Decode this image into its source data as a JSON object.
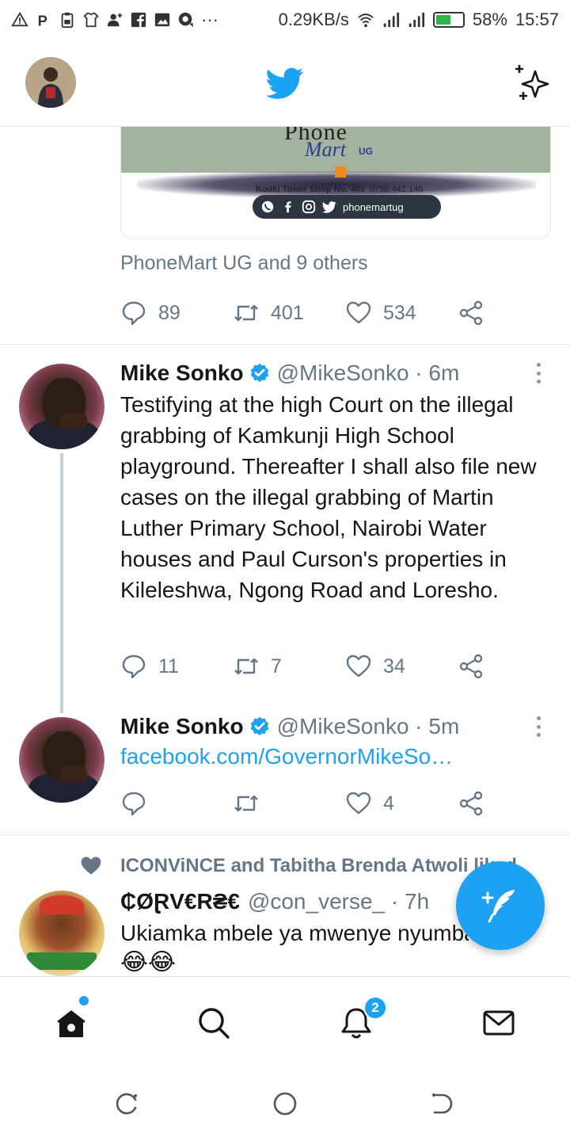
{
  "status_bar": {
    "speed": "0.29KB/s",
    "battery_percent": "58%",
    "battery_level": 0.58,
    "time": "15:57",
    "more_glyph": "···"
  },
  "header": {
    "logo_icon": "twitter-bird-icon",
    "right_icon": "sparkle-icon"
  },
  "feed": {
    "card": {
      "brand_top": "Phone",
      "brand_name": "Mart",
      "brand_suffix": "UG",
      "shop_name": "Kooki Tower Shop No. 463",
      "shop_phone": "0756 442 146",
      "social_handle": "phonemartug"
    },
    "tweet0": {
      "social_context": "PhoneMart UG and 9 others",
      "replies": "89",
      "retweets": "401",
      "likes": "534"
    },
    "tweet1": {
      "name": "Mike Sonko",
      "handle": "@MikeSonko · 6m",
      "text": "Testifying at the high Court on the illegal grabbing of Kamkunji High School playground. Thereafter I shall also file new cases on the illegal grabbing of Martin Luther Primary School, Nairobi Water houses and Paul Curson's properties in Kileleshwa, Ngong Road and Loresho.",
      "replies": "11",
      "retweets": "7",
      "likes": "34"
    },
    "tweet2": {
      "name": "Mike Sonko",
      "handle": "@MikeSonko · 5m",
      "link": "facebook.com/GovernorMikeSo…",
      "likes": "4"
    },
    "tweet3": {
      "liked_by": "ICONViNCE and Tabitha Brenda Atwoli liked",
      "name": "₵ØⱤV€R₴€",
      "handle": "@con_verse_ · 7h",
      "text": "Ukiamka mbele ya mwenye nyumba",
      "emojis": "😂😂"
    }
  },
  "bottom_nav": {
    "items": [
      "home-icon",
      "search-icon",
      "notifications-icon",
      "messages-icon"
    ],
    "notifications_badge": "2"
  },
  "colors": {
    "brand": "#1da1f2",
    "text": "#14171a",
    "muted": "#657786",
    "divider": "#e1e8ed"
  }
}
